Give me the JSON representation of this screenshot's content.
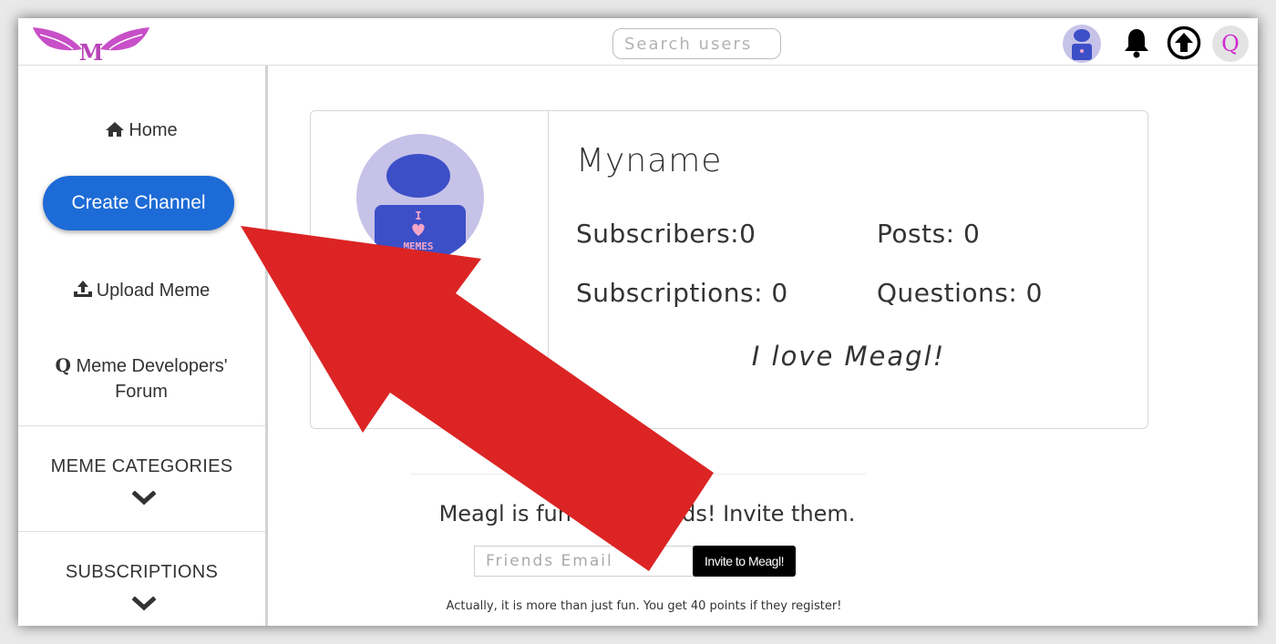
{
  "app": {
    "brand_color": "#c84fc8",
    "accent": "#1d6bd6"
  },
  "header": {
    "logo_letter": "M",
    "search_placeholder": "Search users",
    "icons": [
      "avatar",
      "bell-icon",
      "upload-icon",
      "q-icon"
    ],
    "q_label": "Q"
  },
  "sidebar": {
    "home_label": "Home",
    "create_channel_label": "Create Channel",
    "upload_label": "Upload Meme",
    "forum_icon": "Q",
    "forum_label_line1": "Meme Developers'",
    "forum_label_line2": "Forum",
    "categories_label": "MEME CATEGORIES",
    "subscriptions_label": "SUBSCRIPTIONS"
  },
  "profile": {
    "name": "Myname",
    "subscribers": "Subscribers:0",
    "posts": "Posts: 0",
    "subscriptions": "Subscriptions: 0",
    "questions": "Questions: 0",
    "motto": "I love Meagl!",
    "avatar_text_top": "I",
    "avatar_text_bottom": "MEMES"
  },
  "invite": {
    "title": "Meagl is fun with friends! Invite them.",
    "email_placeholder": "Friends Email",
    "button_label": "Invite to Meagl!",
    "note": "Actually, it is more than just fun. You get 40 points if they register!"
  },
  "overlay": {
    "arrow_color": "#dc2424"
  }
}
